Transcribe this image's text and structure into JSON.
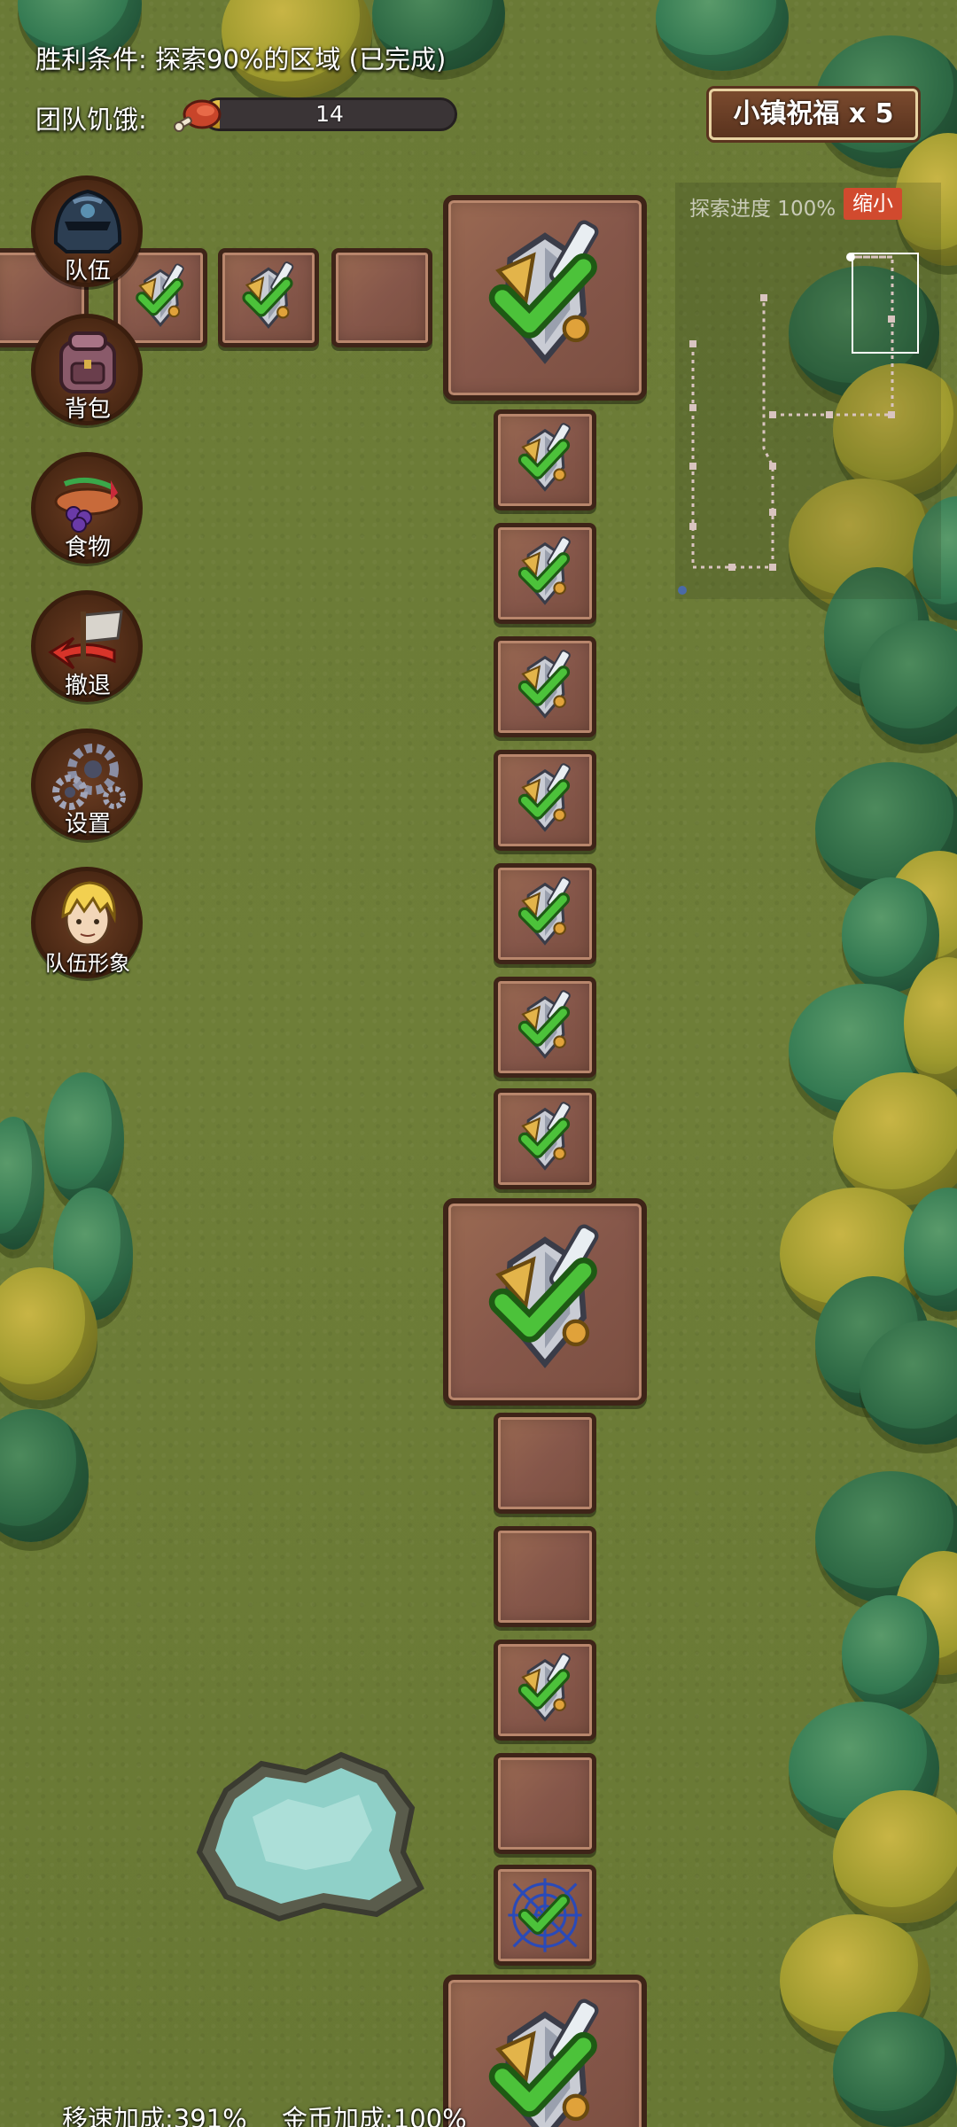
{
  "hud": {
    "victory_condition": "胜利条件: 探索90%的区域 (已完成)",
    "hunger_label": "团队饥饿:",
    "hunger_value": "14",
    "hunger_fraction": 0.06,
    "blessing_label": "小镇祝福 x 5"
  },
  "minimap": {
    "progress_label": "探索进度 100%",
    "shrink_button": "缩小"
  },
  "menu": [
    {
      "label": "队伍",
      "icon": "helmet-icon"
    },
    {
      "label": "背包",
      "icon": "backpack-icon"
    },
    {
      "label": "食物",
      "icon": "food-icon"
    },
    {
      "label": "撤退",
      "icon": "retreat-flag-icon"
    },
    {
      "label": "设置",
      "icon": "gears-icon"
    },
    {
      "label": "队伍形象",
      "icon": "hero-portrait-icon"
    }
  ],
  "footer": {
    "move_speed": "移速加成:391%",
    "gold_bonus": "金币加成:100%"
  },
  "colors": {
    "grass": "#6e7e38",
    "tile": "#86574a",
    "check": "#4cc23a",
    "shrink_button": "#d14a2e"
  }
}
